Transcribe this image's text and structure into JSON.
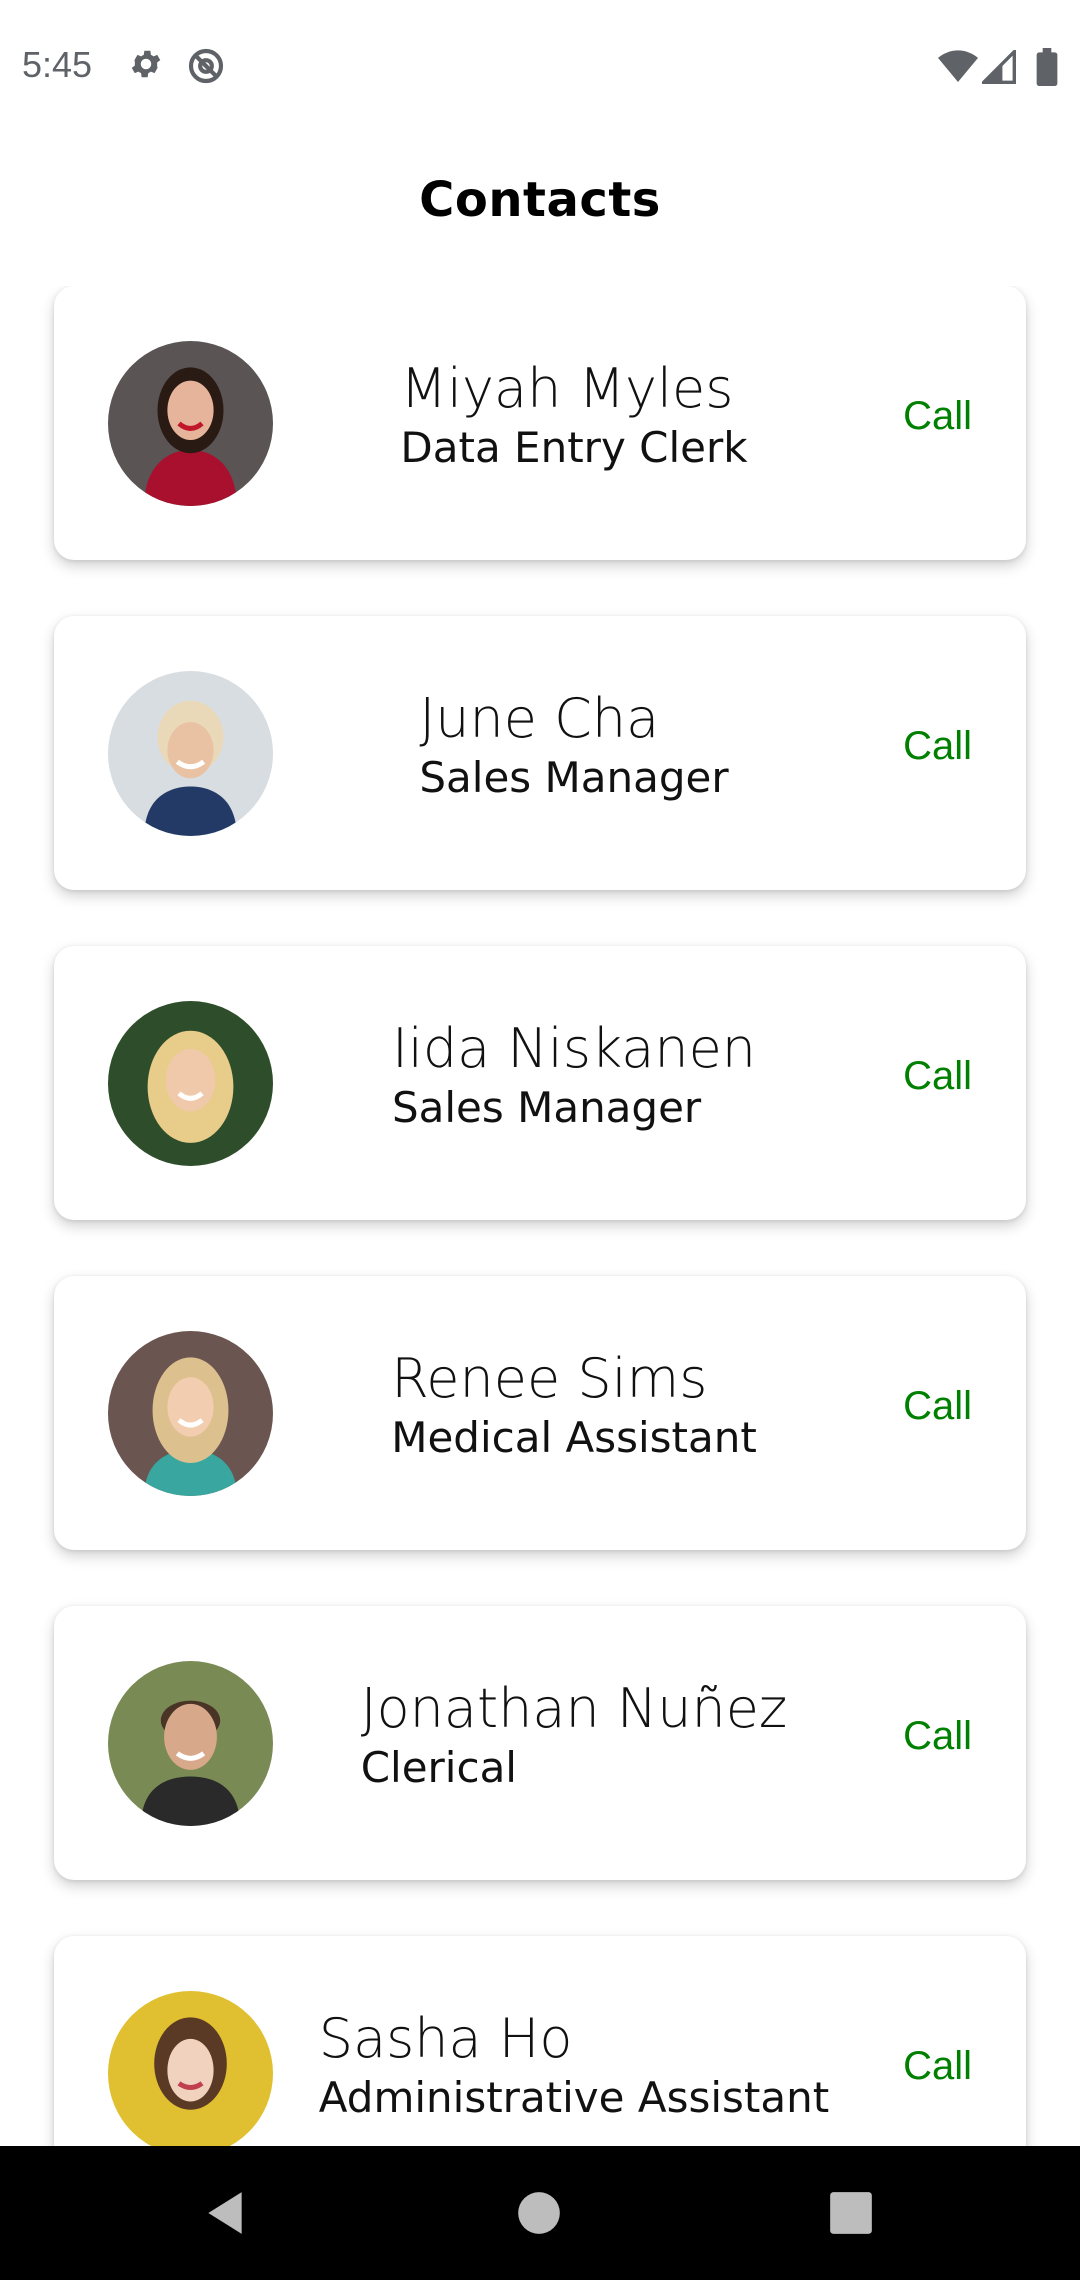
{
  "status_bar": {
    "time": "5:45",
    "icons": [
      "gear-icon",
      "do-not-disturb-icon",
      "wifi-icon",
      "signal-icon",
      "battery-icon"
    ]
  },
  "page": {
    "title": "Contacts"
  },
  "contacts": [
    {
      "name": "Miyah Myles",
      "role": "Data Entry Clerk",
      "action": "Call",
      "avatar_icon": "avatar-photo"
    },
    {
      "name": "June Cha",
      "role": "Sales Manager",
      "action": "Call",
      "avatar_icon": "avatar-photo"
    },
    {
      "name": "Iida Niskanen",
      "role": "Sales Manager",
      "action": "Call",
      "avatar_icon": "avatar-photo"
    },
    {
      "name": "Renee Sims",
      "role": "Medical Assistant",
      "action": "Call",
      "avatar_icon": "avatar-photo"
    },
    {
      "name": "Jonathan Nuñez",
      "role": "Clerical",
      "action": "Call",
      "avatar_icon": "avatar-photo"
    },
    {
      "name": "Sasha Ho",
      "role": "Administrative Assistant",
      "action": "Call",
      "avatar_icon": "avatar-photo"
    }
  ],
  "nav_bar": {
    "buttons": [
      "back-icon",
      "home-icon",
      "recents-icon"
    ]
  },
  "colors": {
    "call": "#008000",
    "background": "#ffffff",
    "nav_bar": "#000000"
  }
}
